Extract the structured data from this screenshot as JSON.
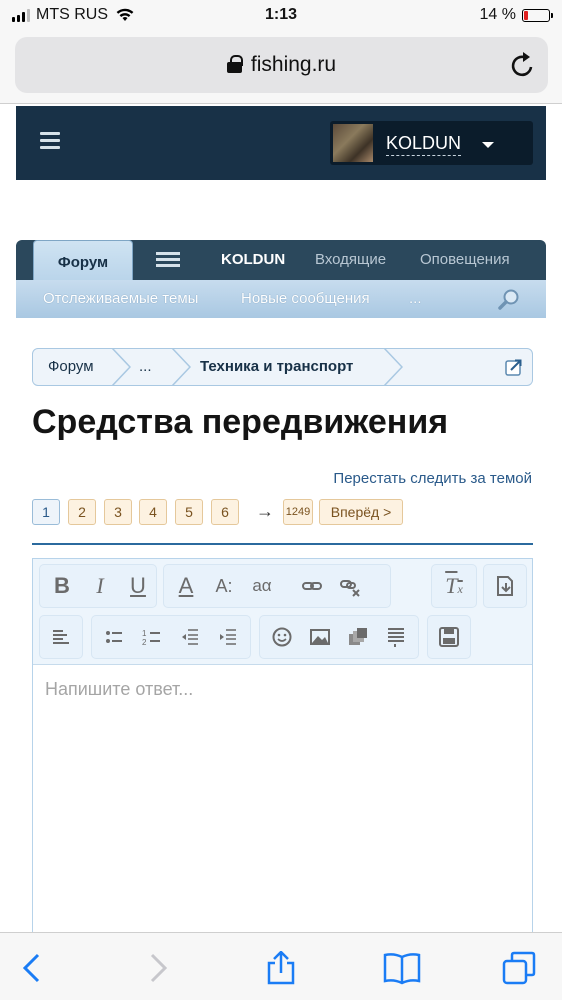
{
  "status_bar": {
    "carrier": "MTS RUS",
    "time": "1:13",
    "battery_percent": "14 %",
    "battery_level": 0.14,
    "signal_bars": 3
  },
  "browser": {
    "url": "fishing.ru"
  },
  "site_header": {
    "username": "KOLDUN"
  },
  "nav": {
    "tabs": [
      {
        "label": "Форум",
        "active": true
      },
      {
        "label": "KOLDUN"
      },
      {
        "label": "Входящие"
      },
      {
        "label": "Оповещения"
      }
    ],
    "sub_links": [
      "Отслеживаемые темы",
      "Новые сообщения",
      "..."
    ]
  },
  "breadcrumb": {
    "items": [
      "Форум",
      "...",
      "Техника и транспорт"
    ]
  },
  "thread": {
    "title": "Средства передвижения",
    "unwatch_label": "Перестать следить за темой"
  },
  "pager": {
    "pages": [
      "1",
      "2",
      "3",
      "4",
      "5",
      "6"
    ],
    "current": "1",
    "arrow": "→",
    "last": "1249",
    "next_label": "Вперёд >"
  },
  "editor": {
    "placeholder": "Напишите ответ..."
  },
  "colors": {
    "header_bg": "#183147",
    "nav_dark": "#2b485c",
    "nav_light": "#a9c8e2",
    "link": "#2a5a8a",
    "ios_blue": "#1a7cf5"
  }
}
